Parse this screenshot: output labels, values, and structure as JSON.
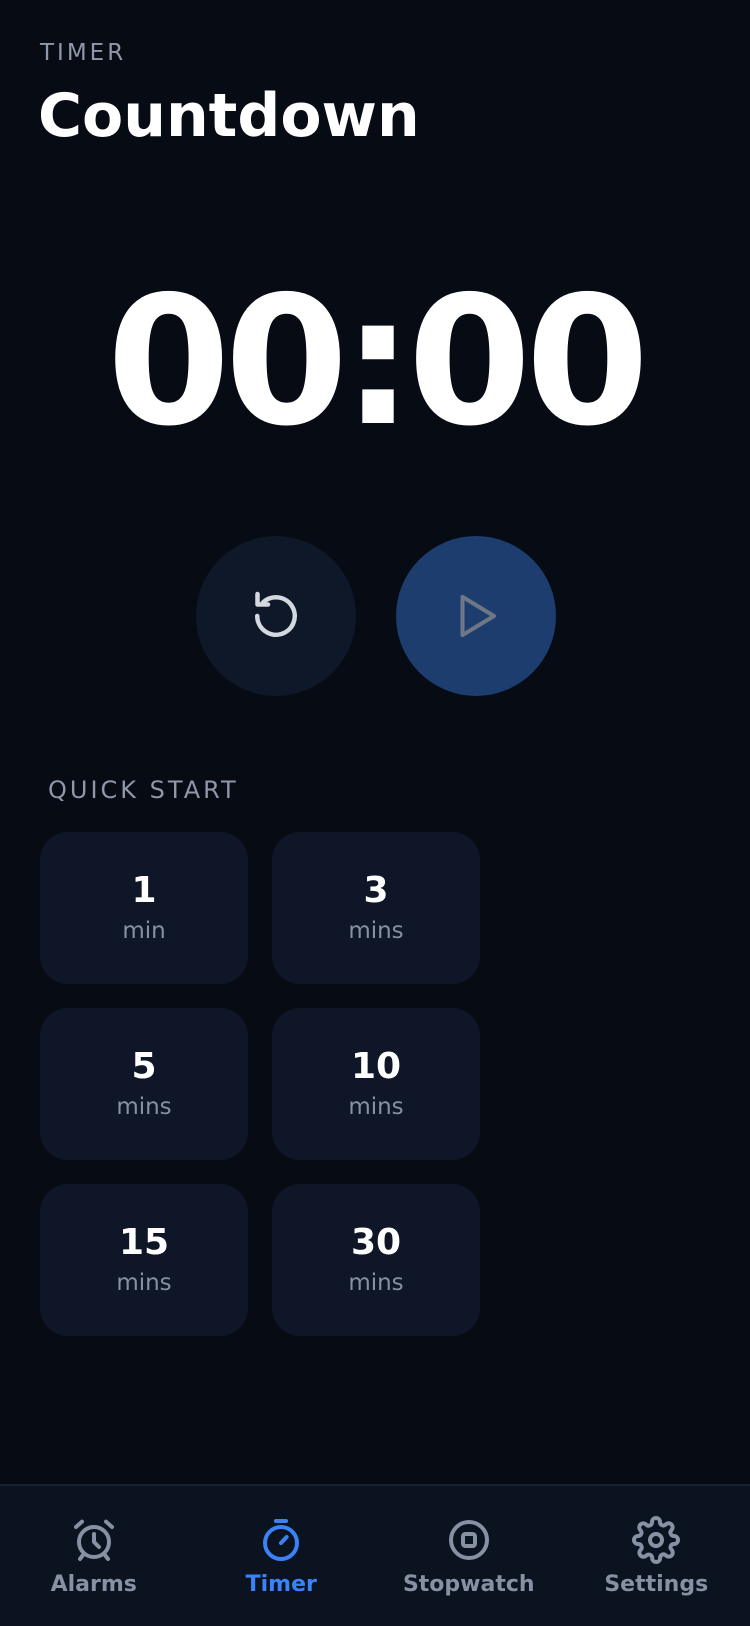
{
  "header": {
    "eyebrow": "TIMER",
    "title": "Countdown"
  },
  "timer": {
    "display": "00:00"
  },
  "controls": {
    "reset_icon": "reset-icon",
    "play_icon": "play-icon"
  },
  "quick_start": {
    "label": "QUICK START",
    "items": [
      {
        "value": "1",
        "unit": "min"
      },
      {
        "value": "3",
        "unit": "mins"
      },
      {
        "value": "5",
        "unit": "mins"
      },
      {
        "value": "10",
        "unit": "mins"
      },
      {
        "value": "15",
        "unit": "mins"
      },
      {
        "value": "30",
        "unit": "mins"
      }
    ]
  },
  "nav": {
    "items": [
      {
        "label": "Alarms",
        "icon": "alarm-clock-icon",
        "active": false
      },
      {
        "label": "Timer",
        "icon": "stopwatch-icon",
        "active": true
      },
      {
        "label": "Stopwatch",
        "icon": "stop-circle-icon",
        "active": false
      },
      {
        "label": "Settings",
        "icon": "gear-icon",
        "active": false
      }
    ]
  },
  "colors": {
    "background": "#060b14",
    "accent": "#3b82f6",
    "play_button": "#1c3d6e",
    "card": "#0e1627",
    "muted_text": "#8691a3"
  }
}
